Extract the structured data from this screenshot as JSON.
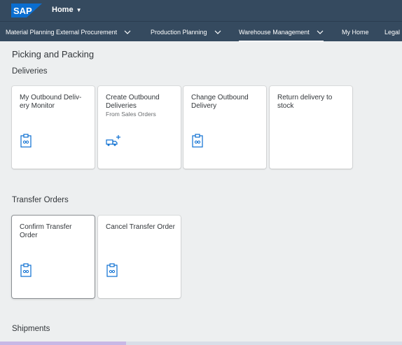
{
  "shell": {
    "logo_text": "SAP",
    "home_label": "Home",
    "brand_color": "#354a5f",
    "logo_color": "#0a6ed1"
  },
  "nav": {
    "items": [
      {
        "label": "Material Planning External Procurement",
        "has_menu": true
      },
      {
        "label": "Production Planning",
        "has_menu": true
      },
      {
        "label": "Warehouse Management",
        "has_menu": true,
        "active": true
      },
      {
        "label": "My Home",
        "has_menu": false
      },
      {
        "label": "Legal",
        "has_menu": false
      }
    ]
  },
  "page": {
    "title": "Picking and Packing"
  },
  "sections": [
    {
      "title": "Deliveries",
      "tiles": [
        {
          "title": "My Outbound Deliv- ery Monitor",
          "subtitle": "",
          "icon": "clipboard-icon"
        },
        {
          "title": "Create Outbound Deliveries",
          "subtitle": "From Sales Orders",
          "icon": "truck-add-icon"
        },
        {
          "title": "Change Outbound Delivery",
          "subtitle": "",
          "icon": "clipboard-icon"
        },
        {
          "title": "Return delivery to stock",
          "subtitle": "",
          "icon": ""
        }
      ]
    },
    {
      "title": "Transfer Orders",
      "tiles": [
        {
          "title": "Confirm Transfer Order",
          "subtitle": "",
          "icon": "clipboard-icon",
          "focused": true
        },
        {
          "title": "Cancel Transfer Order",
          "subtitle": "",
          "icon": "clipboard-icon"
        }
      ]
    },
    {
      "title": "Shipments",
      "tiles": []
    }
  ]
}
